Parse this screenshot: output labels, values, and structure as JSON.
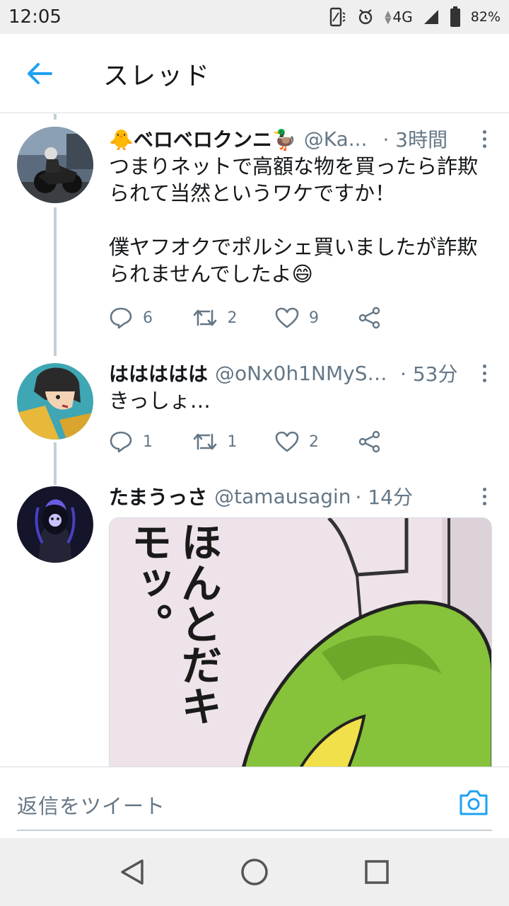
{
  "status_bar": {
    "time": "12:05",
    "network": "4G",
    "battery": "82%"
  },
  "header": {
    "title": "スレッド"
  },
  "tweets": [
    {
      "author": "🐥ベロベロクンニ🦆",
      "handle": "@Ka...",
      "time": "· 3時間",
      "text": "つまりネットで高額な物を買ったら詐欺られて当然というワケですか！\n\n僕ヤフオクでポルシェ買いましたが詐欺られませんでしたよ😄",
      "replies": "6",
      "retweets": "2",
      "likes": "9"
    },
    {
      "author": "ははははは",
      "handle": "@oNx0h1NMySv...",
      "time": "· 53分",
      "text": "きっしょ…",
      "replies": "1",
      "retweets": "1",
      "likes": "2"
    },
    {
      "author": "たまうっさ",
      "handle": "@tamausagin",
      "time": "· 14分",
      "image_text": "ほんとだキモッ。"
    }
  ],
  "reply_bar": {
    "placeholder": "返信をツイート"
  },
  "colors": {
    "accent": "#1da1f2",
    "secondary_text": "#657786",
    "thread_line": "#c4cfd6"
  }
}
